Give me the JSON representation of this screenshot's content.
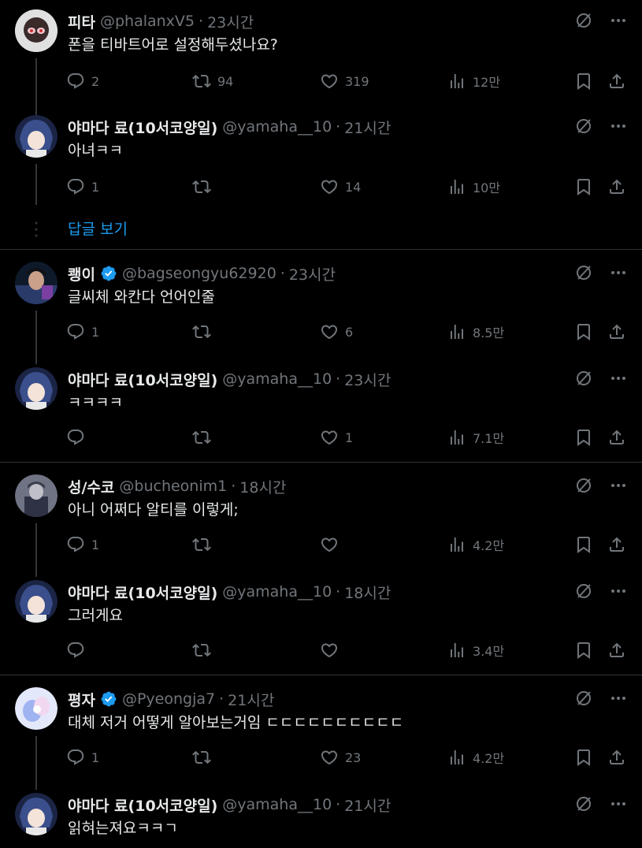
{
  "colors": {
    "bg": "#000000",
    "text": "#e7e9ea",
    "muted": "#71767b",
    "link": "#1d9bf0",
    "divider": "#2f3336",
    "verified": "#1d9bf0"
  },
  "tweets": [
    {
      "name": "피타",
      "handle": "@phalanxV5",
      "time": "23시간",
      "text": "폰을 티바트어로 설정해두셨나요?",
      "replies": "2",
      "retweets": "94",
      "likes": "319",
      "views": "12만",
      "verified": false
    },
    {
      "name": "야마다 료(10서코양일)",
      "handle": "@yamaha__10",
      "time": "21시간",
      "text": "아녀ㅋㅋ",
      "replies": "1",
      "retweets": "",
      "likes": "14",
      "views": "10만",
      "verified": false
    },
    {
      "name": "쾡이",
      "handle": "@bagseongyu62920",
      "time": "23시간",
      "text": "글씨체 와칸다 언어인줄",
      "replies": "1",
      "retweets": "",
      "likes": "6",
      "views": "8.5만",
      "verified": true
    },
    {
      "name": "야마다 료(10서코양일)",
      "handle": "@yamaha__10",
      "time": "23시간",
      "text": "ㅋㅋㅋㅋ",
      "replies": "",
      "retweets": "",
      "likes": "1",
      "views": "7.1만",
      "verified": false
    },
    {
      "name": "성/수코",
      "handle": "@bucheonim1",
      "time": "18시간",
      "text": "아니 어쩌다 알티를 이렇게;",
      "replies": "1",
      "retweets": "",
      "likes": "",
      "views": "4.2만",
      "verified": false
    },
    {
      "name": "야마다 료(10서코양일)",
      "handle": "@yamaha__10",
      "time": "18시간",
      "text": "그러게요",
      "replies": "",
      "retweets": "",
      "likes": "",
      "views": "3.4만",
      "verified": false
    },
    {
      "name": "평자",
      "handle": "@Pyeongja7",
      "time": "21시간",
      "text": "대체 저거 어떻게 알아보는거임 ㄷㄷㄷㄷㄷㄷㄷㄷㄷㄷ",
      "replies": "1",
      "retweets": "",
      "likes": "23",
      "views": "4.2만",
      "verified": true
    },
    {
      "name": "야마다 료(10서코양일)",
      "handle": "@yamaha__10",
      "time": "21시간",
      "text": "읽혀는져요ㅋㅋㄱ",
      "verified": false
    }
  ],
  "show_replies_label": "답글 보기",
  "sep": "·"
}
